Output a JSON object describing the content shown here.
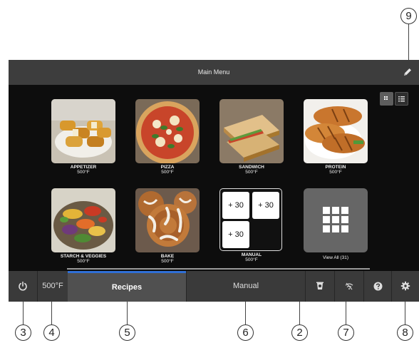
{
  "callouts": {
    "c1": "9",
    "c2": "3",
    "c3": "4",
    "c4": "5",
    "c5": "6",
    "c6": "2",
    "c7": "7",
    "c8": "8"
  },
  "header": {
    "title": "Main Menu",
    "edit_icon": "pencil-icon"
  },
  "view_toggle": {
    "grid_icon": "grid-icon",
    "list_icon": "list-icon",
    "selected": "grid"
  },
  "recipes": [
    {
      "name": "APPETIZER",
      "temp": "500°F"
    },
    {
      "name": "PIZZA",
      "temp": "500°F"
    },
    {
      "name": "SANDWICH",
      "temp": "500°F"
    },
    {
      "name": "PROTEIN",
      "temp": "500°F"
    },
    {
      "name": "STARCH & VEGGIES",
      "temp": "500°F"
    },
    {
      "name": "BAKE",
      "temp": "500°F"
    }
  ],
  "manual": {
    "name": "MANUAL",
    "temp": "500°F",
    "buttons": [
      "+ 30",
      "+ 30",
      "+ 30"
    ]
  },
  "view_all": {
    "label": "View All (31)"
  },
  "bottom_bar": {
    "power_icon": "power-icon",
    "temperature": "500°F",
    "tab_recipes": "Recipes",
    "tab_manual": "Manual",
    "selected_tab": "Recipes",
    "icons": [
      "cleaning-icon",
      "wifi-off-icon",
      "help-icon",
      "settings-icon"
    ]
  },
  "colors": {
    "accent": "#2f6fd6",
    "screen_bg": "#0d0d0d",
    "bar_bg": "#3a3a3a"
  }
}
